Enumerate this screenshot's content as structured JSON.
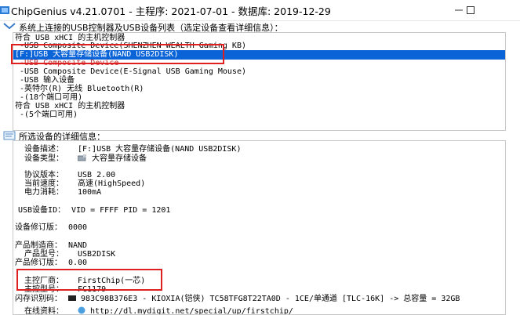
{
  "window": {
    "title": "ChipGenius v4.21.0701 - 主程序: 2021-07-01 - 数据库: 2019-12-29",
    "minimize_symbol": "—",
    "maximize_symbol": "☐"
  },
  "device_list": {
    "label": "系统上连接的USB控制器及USB设备列表（选定设备查看详细信息）：",
    "items": [
      "符合 USB xHCI 的主机控制器",
      "-USB Composite Device(SHENZHEN WEALTH Gaming KB)",
      "[F:]USB 大容量存储设备(NAND USB2DISK)",
      "-USB Composite Device",
      "-USB Composite Device(E-Signal USB Gaming Mouse)",
      "-USB 输入设备",
      "-英特尔(R) 无线 Bluetooth(R)",
      "-(18个端口可用)",
      "符合 USB xHCI 的主机控制器",
      "-(5个端口可用)"
    ]
  },
  "details": {
    "label": "所选设备的详细信息：",
    "device_desc_label": "设备描述：",
    "device_desc": "[F:]USB 大容量存储设备(NAND USB2DISK)",
    "device_type_label": "设备类型：",
    "device_type": "大容量存储设备",
    "protocol_label": "协议版本：",
    "protocol": "USB 2.00",
    "current_speed_label": "当前速度：",
    "current_speed": "高速(HighSpeed)",
    "power_label": "电力消耗：",
    "power": "100mA",
    "usb_id_label": "USB设备ID：",
    "usb_id": "VID = FFFF PID = 1201",
    "revision_label": "设备修订版：",
    "revision": "0000",
    "vendor_label": "产品制造商：",
    "vendor": "NAND",
    "model_label": "产品型号：",
    "model": "USB2DISK",
    "product_rev_label": "产品修订版：",
    "product_rev": "0.00",
    "controller_vendor_label": "主控厂商：",
    "controller_vendor": "FirstChip(一芯)",
    "controller_model_label": "主控型号：",
    "controller_model": "FC1179",
    "flash_id_label": "闪存识别码：",
    "flash_id": "983C98B376E3 - KIOXIA(铠侠) TC58TFG8T22TA0D - 1CE/单通道 [TLC-16K] -> 总容量 = 32GB",
    "online_label": "在线资料：",
    "online": "http://dl.mydigit.net/special/up/firstchip/"
  },
  "colors": {
    "selection": "#0a64d8",
    "highlight_box": "#e02020",
    "panel_border": "#c8c8c8"
  }
}
